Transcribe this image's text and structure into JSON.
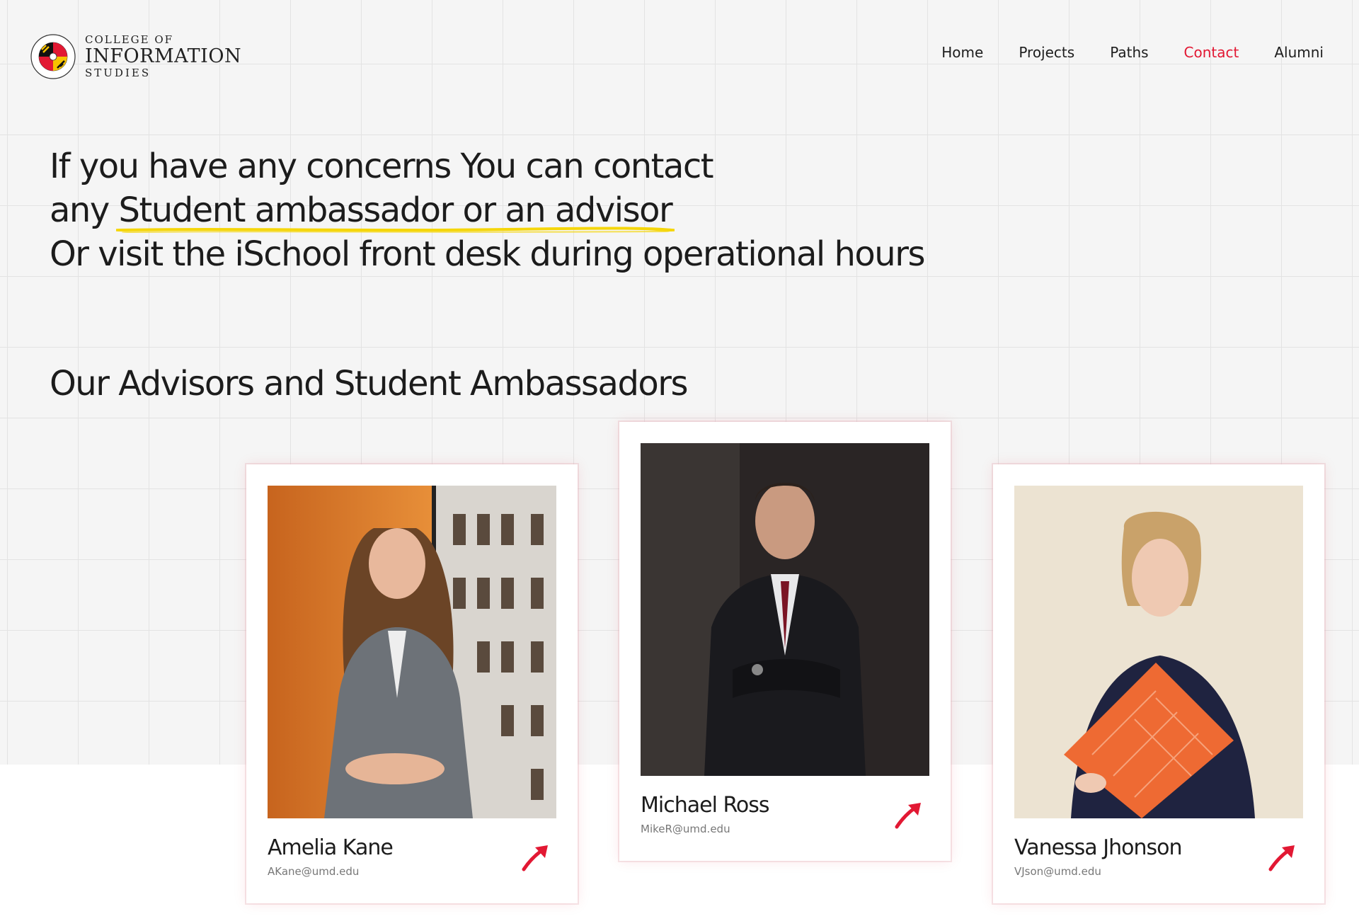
{
  "brand": {
    "line1": "COLLEGE OF",
    "line2": "INFORMATION",
    "line3": "STUDIES",
    "seal_text_top": "UNIVERSITY OF",
    "seal_text_bottom": "MARYLAND"
  },
  "nav": {
    "items": [
      {
        "label": "Home"
      },
      {
        "label": "Projects"
      },
      {
        "label": "Paths"
      },
      {
        "label": "Contact"
      },
      {
        "label": "Alumni"
      }
    ],
    "active": "Contact"
  },
  "hero": {
    "line1": "If you have any concerns You can contact",
    "line2_prefix": "any ",
    "line2_highlight": "Student ambassador or an advisor",
    "line3": "Or visit the iSchool front desk during operational hours"
  },
  "section": {
    "title": "Our Advisors and Student Ambassadors"
  },
  "people": [
    {
      "name": "Amelia Kane",
      "email": "AKane@umd.edu"
    },
    {
      "name": "Michael Ross",
      "email": "MikeR@umd.edu"
    },
    {
      "name": "Vanessa Jhonson",
      "email": "VJson@umd.edu"
    }
  ],
  "colors": {
    "accent": "#e21833",
    "highlight": "#f5d60a",
    "grid_bg": "#f5f5f5"
  }
}
